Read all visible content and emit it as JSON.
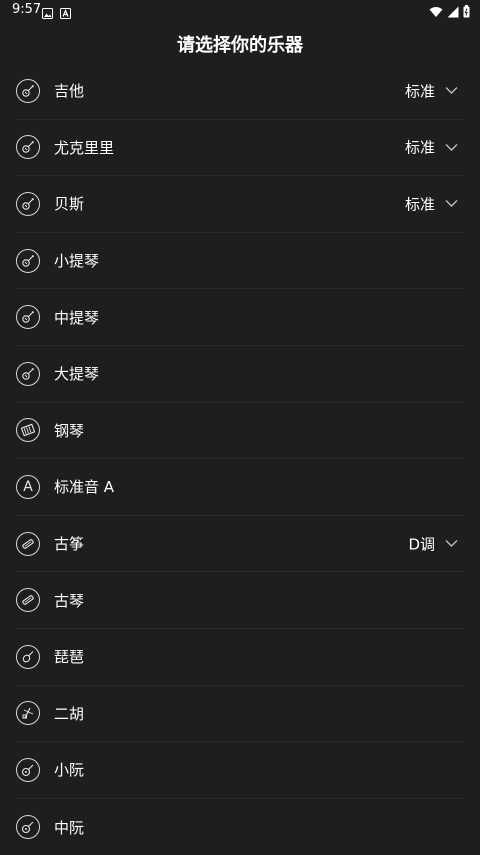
{
  "status": {
    "time": "9:57"
  },
  "title": "请选择你的乐器",
  "items": [
    {
      "label": "吉他",
      "value": "标准",
      "icon": "guitar-icon"
    },
    {
      "label": "尤克里里",
      "value": "标准",
      "icon": "ukulele-icon"
    },
    {
      "label": "贝斯",
      "value": "标准",
      "icon": "bass-icon"
    },
    {
      "label": "小提琴",
      "value": "",
      "icon": "violin-icon"
    },
    {
      "label": "中提琴",
      "value": "",
      "icon": "viola-icon"
    },
    {
      "label": "大提琴",
      "value": "",
      "icon": "cello-icon"
    },
    {
      "label": "钢琴",
      "value": "",
      "icon": "piano-icon"
    },
    {
      "label": "标准音 A",
      "value": "",
      "icon": "letter-a-icon",
      "icon_letter": "A"
    },
    {
      "label": "古筝",
      "value": "D调",
      "icon": "guzheng-icon"
    },
    {
      "label": "古琴",
      "value": "",
      "icon": "guqin-icon"
    },
    {
      "label": "琵琶",
      "value": "",
      "icon": "pipa-icon"
    },
    {
      "label": "二胡",
      "value": "",
      "icon": "erhu-icon"
    },
    {
      "label": "小阮",
      "value": "",
      "icon": "xiaoruan-icon"
    },
    {
      "label": "中阮",
      "value": "",
      "icon": "zhongruan-icon"
    }
  ],
  "colors": {
    "background": "#1e1e20",
    "divider": "#2c2c2f",
    "text": "#ffffff"
  }
}
